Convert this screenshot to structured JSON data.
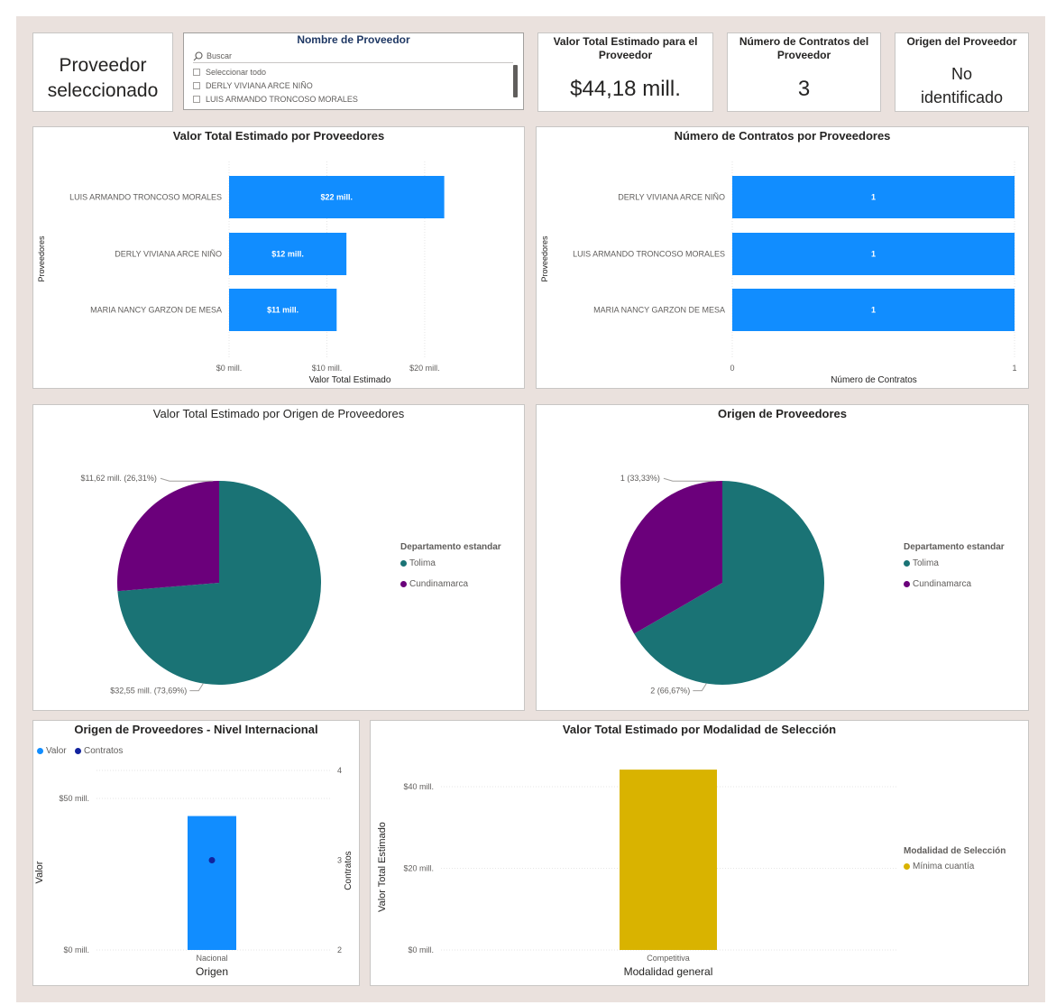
{
  "colors": {
    "bar_blue": "#118dff",
    "teal": "#1a7375",
    "purple": "#6b007b",
    "navy": "#12239e",
    "gold": "#d9b300"
  },
  "selected_card": {
    "text": "Proveedor seleccionado"
  },
  "slicer": {
    "title": "Nombre de Proveedor",
    "search_placeholder": "Buscar",
    "icon": "search-icon",
    "items": [
      "Seleccionar todo",
      "DERLY VIVIANA ARCE NIÑO",
      "LUIS ARMANDO TRONCOSO MORALES"
    ]
  },
  "kpis": [
    {
      "title": "Valor Total Estimado para el Proveedor",
      "value": "$44,18 mill."
    },
    {
      "title": "Número de Contratos del Proveedor",
      "value": "3"
    },
    {
      "title": "Origen del Proveedor",
      "value": "No identificado"
    }
  ],
  "charts": {
    "valor_proveedores": {
      "title": "Valor Total Estimado por Proveedores",
      "type": "bar",
      "orientation": "horizontal",
      "ylabel": "Proveedores",
      "xlabel": "Valor Total Estimado",
      "categories": [
        "LUIS ARMANDO TRONCOSO MORALES",
        "DERLY VIVIANA ARCE NIÑO",
        "MARIA NANCY GARZON DE MESA"
      ],
      "values": [
        22,
        12,
        11
      ],
      "data_labels": [
        "$22 mill.",
        "$12 mill.",
        "$11 mill."
      ],
      "xticks": [
        "$0 mill.",
        "$10 mill.",
        "$20 mill."
      ],
      "xlim": [
        0,
        26
      ],
      "grid": true
    },
    "contratos_proveedores": {
      "title": "Número de Contratos por Proveedores",
      "type": "bar",
      "orientation": "horizontal",
      "ylabel": "Proveedores",
      "xlabel": "Número de Contratos",
      "categories": [
        "DERLY VIVIANA ARCE NIÑO",
        "LUIS ARMANDO TRONCOSO MORALES",
        "MARIA NANCY GARZON DE MESA"
      ],
      "values": [
        1,
        1,
        1
      ],
      "data_labels": [
        "1",
        "1",
        "1"
      ],
      "xticks": [
        "0",
        "1"
      ],
      "xlim": [
        0,
        1
      ],
      "grid": true
    },
    "valor_origen": {
      "title": "Valor Total Estimado por Origen de Proveedores",
      "type": "pie",
      "legend_title": "Departamento estandar",
      "legend_position": "right",
      "slices": [
        {
          "name": "Tolima",
          "value": 32.55,
          "percent": 73.69,
          "label": "$32,55 mill. (73,69%)"
        },
        {
          "name": "Cundinamarca",
          "value": 11.62,
          "percent": 26.31,
          "label": "$11,62 mill. (26,31%)"
        }
      ]
    },
    "origen_proveedores": {
      "title": "Origen de Proveedores",
      "type": "pie",
      "legend_title": "Departamento estandar",
      "legend_position": "right",
      "slices": [
        {
          "name": "Tolima",
          "value": 2,
          "percent": 66.67,
          "label": "2 (66,67%)"
        },
        {
          "name": "Cundinamarca",
          "value": 1,
          "percent": 33.33,
          "label": "1 (33,33%)"
        }
      ]
    },
    "internacional": {
      "title": "Origen de Proveedores - Nivel Internacional",
      "type": "bar",
      "legend": [
        "Valor",
        "Contratos"
      ],
      "legend_position": "top-left",
      "categories": [
        "Nacional"
      ],
      "values": [
        44.18
      ],
      "contratos": [
        3
      ],
      "ylabel": "Valor",
      "y2label": "Contratos",
      "xlabel": "Origen",
      "yticks": [
        "$0 mill.",
        "$50 mill."
      ],
      "y2ticks": [
        "2",
        "3",
        "4"
      ],
      "ylim": [
        0,
        50
      ],
      "y2lim": [
        2,
        4
      ]
    },
    "modalidad": {
      "title": "Valor Total Estimado por Modalidad de Selección",
      "type": "bar",
      "categories": [
        "Competitiva"
      ],
      "values": [
        44.18
      ],
      "ylabel": "Valor Total Estimado",
      "xlabel": "Modalidad general",
      "yticks": [
        "$0 mill.",
        "$20 mill.",
        "$40 mill."
      ],
      "ylim": [
        0,
        40
      ],
      "legend_title": "Modalidad de Selección",
      "legend": [
        "Mínima cuantía"
      ],
      "legend_position": "right"
    }
  }
}
